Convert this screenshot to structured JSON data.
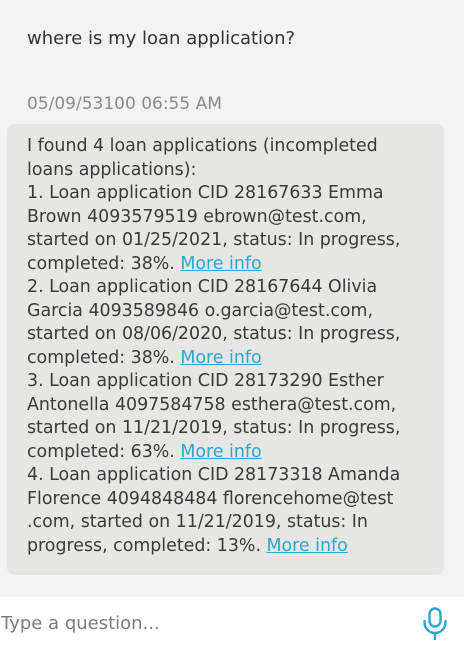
{
  "conversation": {
    "user_message": "where is my loan application?",
    "timestamp": "05/09/53100 06:55 AM",
    "bot_lines": {
      "l1": "I found 4 loan applications (incompleted",
      "l2": "loans applications):",
      "a1_l1": "1. Loan application CID 28167633 Emma",
      "a1_l2": "Brown 4093579519 ebrown@test.com,",
      "a1_l3": "started on 01/25/2021, status: In progress,",
      "a1_l4": "completed: 38%.",
      "a2_l1": "2. Loan application CID 28167644 Olivia",
      "a2_l2": "Garcia 4093589846 o.garcia@test.com,",
      "a2_l3": "started on 08/06/2020, status: In progress,",
      "a2_l4": "completed: 38%.",
      "a3_l1": "3. Loan application CID 28173290 Esther",
      "a3_l2": "Antonella 4097584758 esthera@test.com,",
      "a3_l3": "started on 11/21/2019, status: In progress,",
      "a3_l4": "completed: 63%.",
      "a4_l1": "4. Loan application CID 28173318 Amanda",
      "a4_l2": "Florence 4094848484 florencehome@test",
      "a4_l3": ".com, started on 11/21/2019, status: In",
      "a4_l4": "progress, completed: 13%."
    },
    "more_info_label": "More info"
  },
  "input": {
    "placeholder": "Type a question..."
  },
  "icons": {
    "mic": "microphone-icon"
  },
  "colors": {
    "background": "#f3f3f3",
    "bubble": "#e6e6e4",
    "link": "#2aa7cf",
    "mic": "#2aa7cf",
    "input_bar": "#ffffff"
  }
}
